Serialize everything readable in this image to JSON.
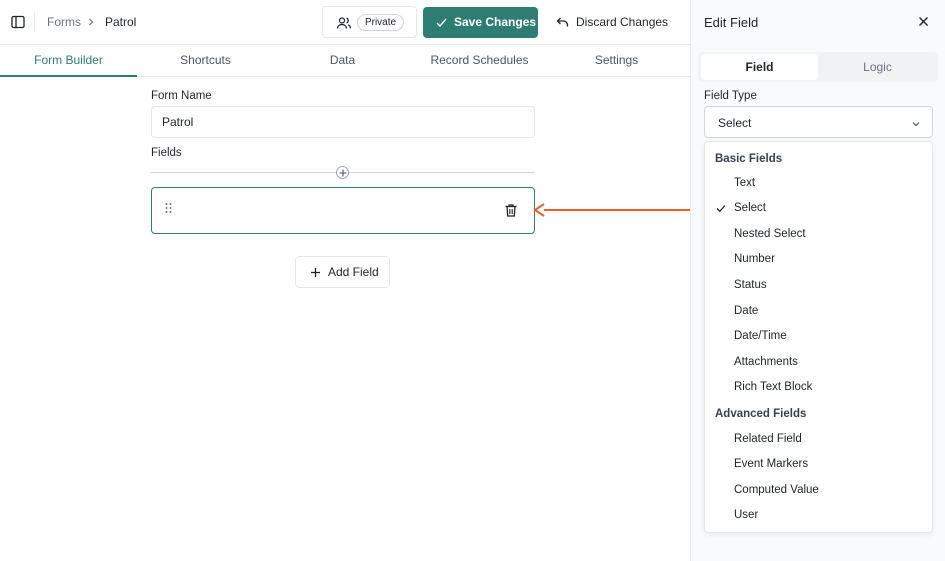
{
  "breadcrumb": {
    "root": "Forms",
    "current": "Patrol"
  },
  "header": {
    "private_label": "Private",
    "save_label": "Save Changes",
    "discard_label": "Discard Changes"
  },
  "tabs": [
    {
      "label": "Form Builder",
      "active": true
    },
    {
      "label": "Shortcuts",
      "active": false
    },
    {
      "label": "Data",
      "active": false
    },
    {
      "label": "Record Schedules",
      "active": false
    },
    {
      "label": "Settings",
      "active": false
    }
  ],
  "builder": {
    "form_name_label": "Form Name",
    "form_name_value": "Patrol",
    "fields_label": "Fields",
    "add_field_label": "Add Field"
  },
  "panel": {
    "title": "Edit Field",
    "tabs": [
      {
        "label": "Field",
        "active": true
      },
      {
        "label": "Logic",
        "active": false
      }
    ],
    "field_type_label": "Field Type",
    "field_type_value": "Select",
    "groups": [
      {
        "label": "Basic Fields",
        "options": [
          "Text",
          "Select",
          "Nested Select",
          "Number",
          "Status",
          "Date",
          "Date/Time",
          "Attachments",
          "Rich Text Block"
        ]
      },
      {
        "label": "Advanced Fields",
        "options": [
          "Related Field",
          "Event Markers",
          "Computed Value",
          "User"
        ]
      }
    ],
    "selected_option": "Select"
  },
  "colors": {
    "accent": "#2e7d73",
    "arrow": "#e8602c"
  }
}
